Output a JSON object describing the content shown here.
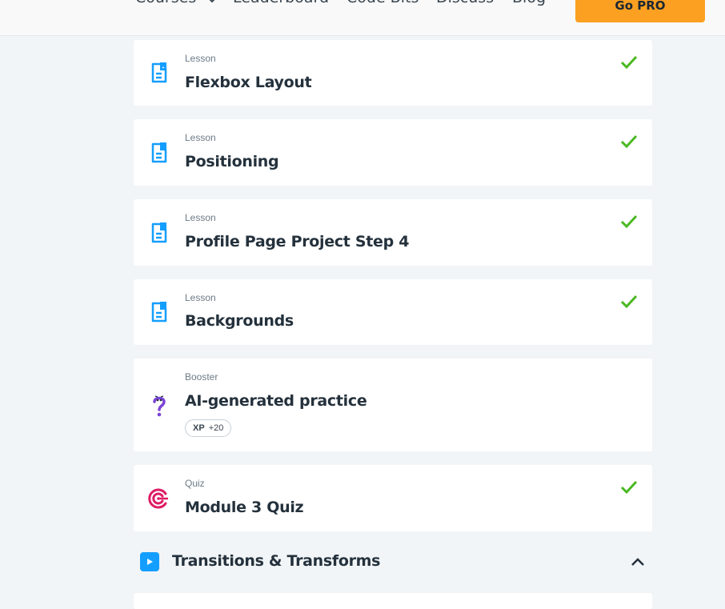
{
  "nav": {
    "courses": "Courses",
    "leaderboard": "Leaderboard",
    "code_bits": "Code Bits",
    "discuss": "Discuss",
    "blog": "Blog",
    "go_pro": "Go PRO"
  },
  "cards": [
    {
      "type": "Lesson",
      "title": "Flexbox Layout",
      "icon": "lesson-icon",
      "completed": true
    },
    {
      "type": "Lesson",
      "title": "Positioning",
      "icon": "lesson-icon",
      "completed": true
    },
    {
      "type": "Lesson",
      "title": "Profile Page Project Step 4",
      "icon": "lesson-icon",
      "completed": true
    },
    {
      "type": "Lesson",
      "title": "Backgrounds",
      "icon": "lesson-icon",
      "completed": true
    },
    {
      "type": "Booster",
      "title": "AI-generated practice",
      "icon": "question-mark-icon",
      "completed": false,
      "xp_label": "XP",
      "xp_value": "+20"
    },
    {
      "type": "Quiz",
      "title": "Module 3 Quiz",
      "icon": "target-icon",
      "completed": true
    }
  ],
  "section": {
    "title": "Transitions & Transforms",
    "icon": "play-icon"
  },
  "colors": {
    "accent_orange": "#fba020",
    "check_green": "#49b821",
    "lesson_blue": "#149eff",
    "quiz_pink": "#de1c63",
    "booster_purple": "#7b44d6"
  }
}
